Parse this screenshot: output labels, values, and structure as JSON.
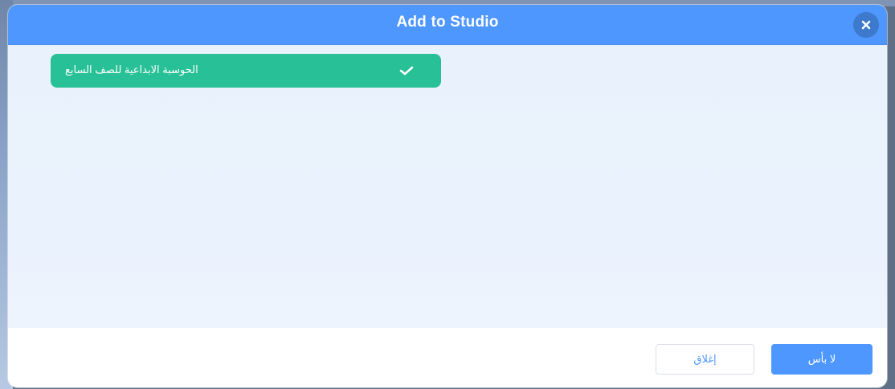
{
  "modal": {
    "title": "Add to Studio",
    "close_icon": "close-icon"
  },
  "studios": [
    {
      "label": "الحوسبة الابداعية للصف السابع",
      "selected": true,
      "icon": "check-icon"
    }
  ],
  "footer": {
    "cancel_label": "إغلاق",
    "ok_label": "لا بأس"
  },
  "colors": {
    "header": "#4d97ff",
    "close_button": "#3d79cc",
    "body": "#e9f1fc",
    "selected_item": "#28c096",
    "ok_button": "#4d97ff",
    "cancel_text": "#4d97ff"
  }
}
